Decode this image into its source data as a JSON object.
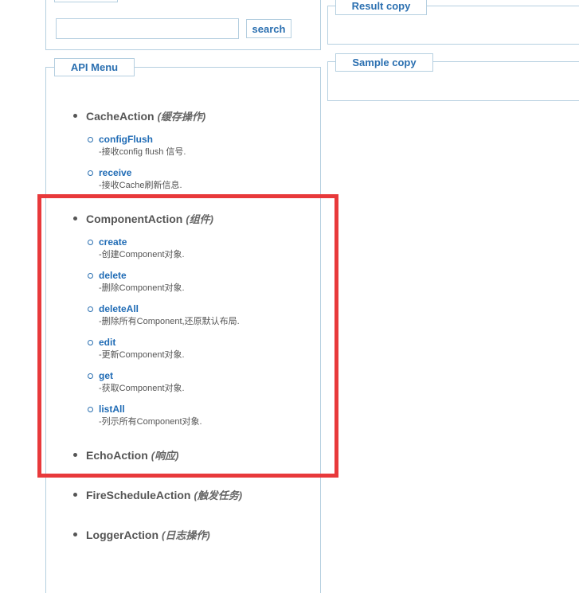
{
  "search": {
    "input_value": "",
    "input_placeholder": "",
    "button_label": "search"
  },
  "result_panel": {
    "legend": "Result copy"
  },
  "sample_panel": {
    "legend": "Sample copy"
  },
  "api_menu": {
    "legend": "API Menu",
    "sections": [
      {
        "name": "CacheAction",
        "sub": "(缓存操作)",
        "actions": [
          {
            "name": "configFlush",
            "desc": "-接收config flush 信号."
          },
          {
            "name": "receive",
            "desc": "-接收Cache刷新信息."
          }
        ]
      },
      {
        "name": "ComponentAction",
        "sub": "(组件)",
        "actions": [
          {
            "name": "create",
            "desc": "-创建Component对象."
          },
          {
            "name": "delete",
            "desc": "-删除Component对象."
          },
          {
            "name": "deleteAll",
            "desc": "-删除所有Component,还原默认布局."
          },
          {
            "name": "edit",
            "desc": "-更新Component对象."
          },
          {
            "name": "get",
            "desc": "-获取Component对象."
          },
          {
            "name": "listAll",
            "desc": "-列示所有Component对象."
          }
        ]
      },
      {
        "name": "EchoAction",
        "sub": "(响应)",
        "actions": []
      },
      {
        "name": "FireScheduleAction",
        "sub": "(触发任务)",
        "actions": []
      },
      {
        "name": "LoggerAction",
        "sub": "(日志操作)",
        "actions": []
      }
    ]
  },
  "colors": {
    "accent": "#2a6fb0",
    "border": "#b5cfe0",
    "highlight": "#e8393b"
  }
}
